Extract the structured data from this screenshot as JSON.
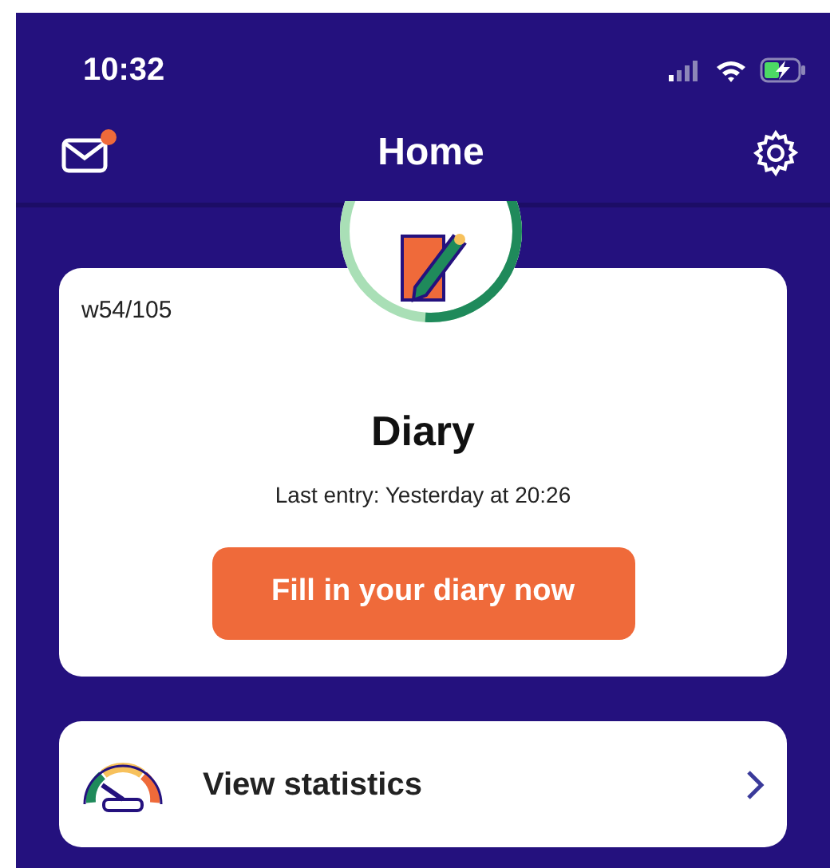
{
  "status_bar": {
    "time": "10:32"
  },
  "nav": {
    "title": "Home",
    "mail_unread": true
  },
  "diary_card": {
    "week": "w54/105",
    "level": 0.51,
    "title": "Diary",
    "last_entry": "Last entry: Yesterday at 20:26",
    "button": "Fill in your diary now"
  },
  "statistics_link": {
    "label": "View statistics"
  }
}
